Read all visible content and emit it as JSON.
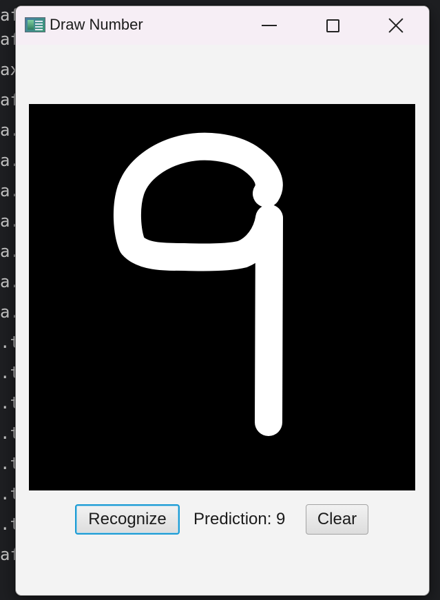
{
  "background_code": {
    "fragments": [
      "af",
      "af",
      "ax",
      "af",
      "a.",
      "a.",
      "a.",
      "a.",
      "a.",
      "a.",
      "a.",
      ".t",
      ".t",
      ".t",
      ".t",
      ".t",
      ".t",
      ".t",
      "af"
    ]
  },
  "window": {
    "title": "Draw Number",
    "icon": "app-window-icon",
    "controls": {
      "minimize_icon": "minimize-icon",
      "maximize_icon": "maximize-icon",
      "close_icon": "close-icon"
    }
  },
  "canvas": {
    "background": "#000000",
    "stroke_color": "#ffffff",
    "drawn_digit": "9"
  },
  "controls": {
    "recognize_label": "Recognize",
    "prediction_text": "Prediction: 9",
    "clear_label": "Clear"
  },
  "colors": {
    "focus_accent": "#1a9bd4",
    "window_bg": "#f3f3f3",
    "titlebar_bg": "#f6eef5"
  }
}
